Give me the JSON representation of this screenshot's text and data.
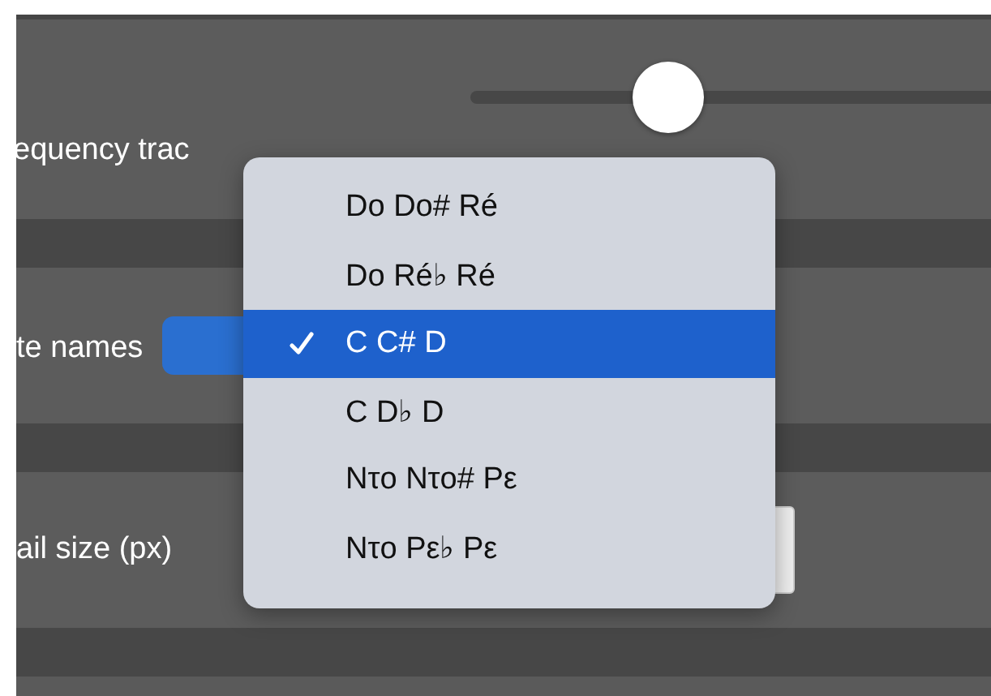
{
  "rows": [
    {
      "kind": "slider",
      "label": "equency trac",
      "level": 0.37
    },
    {
      "kind": "select",
      "label": "te names"
    },
    {
      "kind": "input",
      "label": "ail size (px)"
    }
  ],
  "menu": {
    "items": [
      {
        "label": "Do Do# Ré",
        "selected": false
      },
      {
        "label": "Do Ré♭ Ré",
        "selected": false
      },
      {
        "label": "C C# D",
        "selected": true
      },
      {
        "label": "C D♭ D",
        "selected": false
      },
      {
        "label": "Nτo Nτo# Pε",
        "selected": false
      },
      {
        "label": "Nτo Pε♭ Pε",
        "selected": false
      }
    ]
  }
}
